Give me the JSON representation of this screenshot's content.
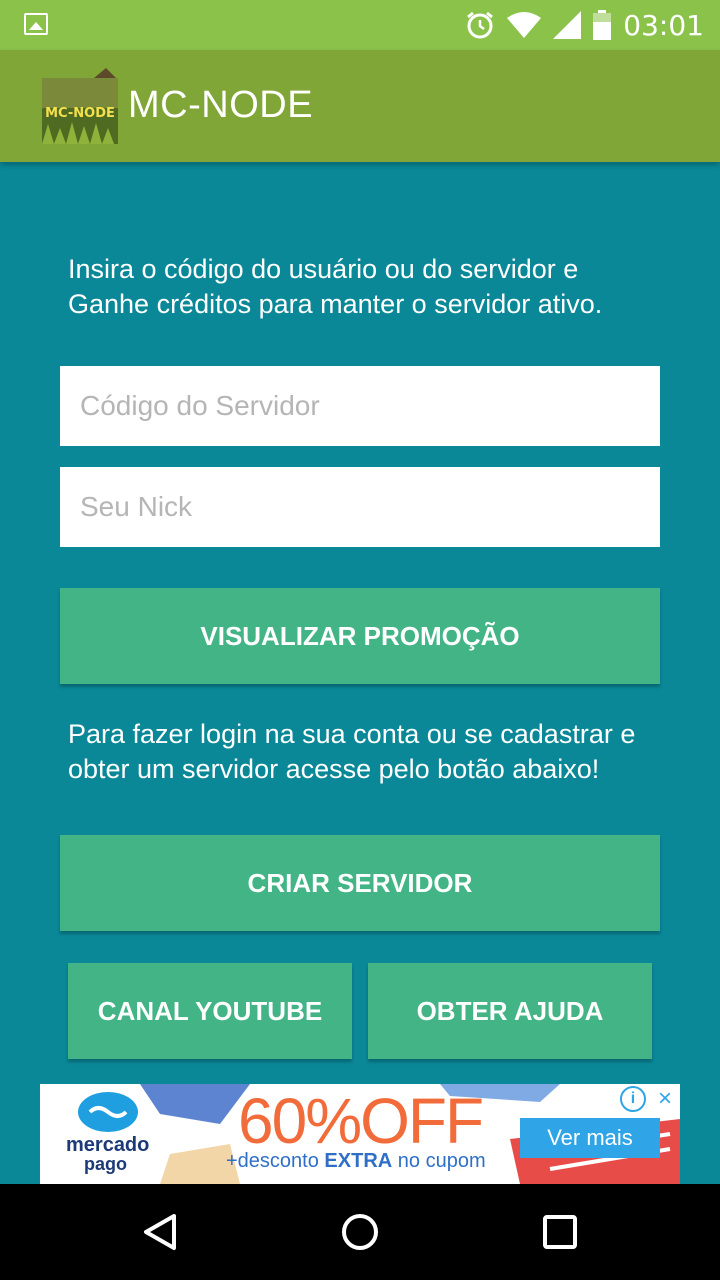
{
  "status_bar": {
    "time": "03:01",
    "icons": [
      "image-icon",
      "alarm-icon",
      "wifi-icon",
      "signal-icon",
      "battery-icon"
    ]
  },
  "app_bar": {
    "title": "MC-NODE",
    "logo_text": "MC-NODE"
  },
  "main": {
    "intro_text": "Insira o código do usuário ou do servidor e Ganhe créditos para manter o servidor ativo.",
    "server_code_placeholder": "Código do Servidor",
    "server_code_value": "",
    "nick_placeholder": "Seu Nick",
    "nick_value": "",
    "view_promo_label": "VISUALIZAR PROMOÇÃO",
    "login_text": "Para fazer login na sua conta ou se cadastrar e obter um servidor acesse pelo botão abaixo!",
    "create_server_label": "CRIAR SERVIDOR",
    "youtube_label": "CANAL YOUTUBE",
    "help_label": "OBTER AJUDA"
  },
  "ad": {
    "brand_line1": "mercado",
    "brand_line2": "pago",
    "discount": "60%OFF",
    "subtext_prefix": "+desconto ",
    "subtext_bold": "EXTRA",
    "subtext_suffix": " no cupom",
    "cta": "Ver mais"
  },
  "colors": {
    "status_bar": "#8bc34a",
    "app_bar": "#7fa637",
    "background": "#0a8898",
    "button": "#42b485",
    "ad_discount": "#f26b3a",
    "ad_cta": "#2fa4e7"
  }
}
